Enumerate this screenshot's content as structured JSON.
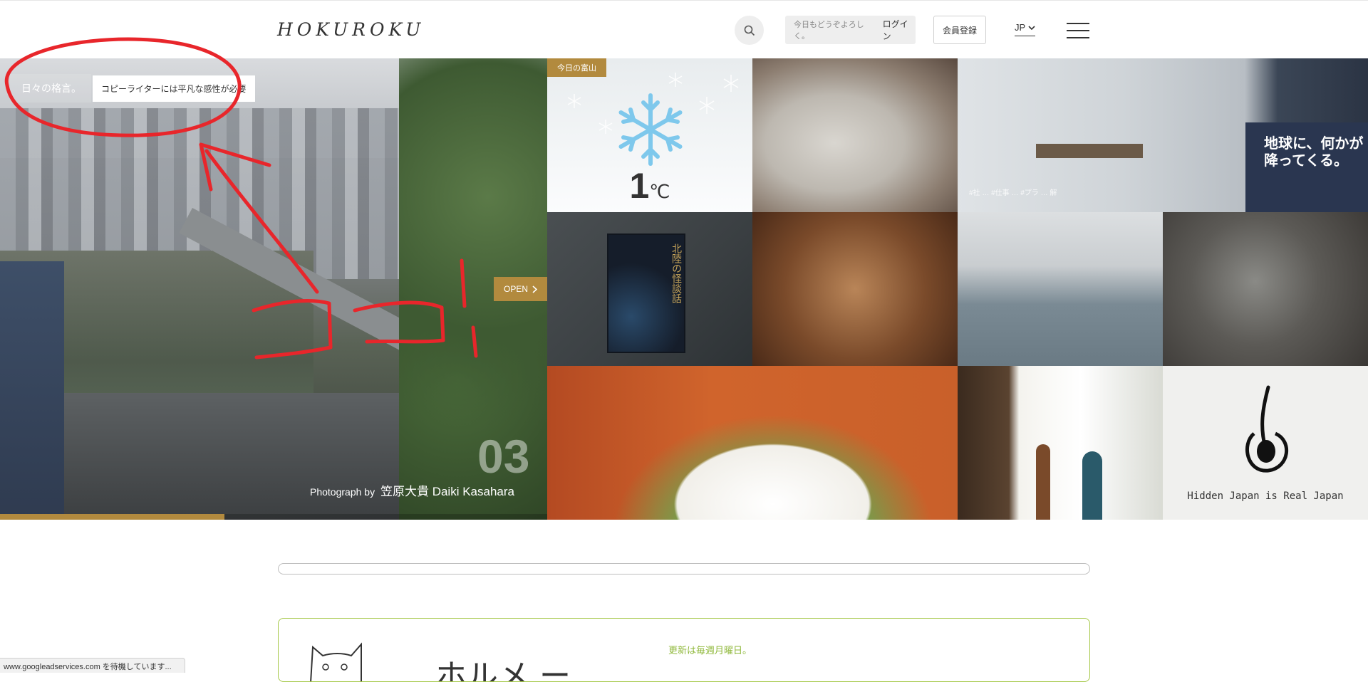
{
  "header": {
    "logo": "HOKUROKU",
    "login_placeholder": "今日もどうぞよろしく。",
    "login_label": "ログイン",
    "register_label": "会員登録",
    "language": "JP"
  },
  "hero": {
    "quote_title": "日々の格言。",
    "quote_text": "コピーライターには平凡な感性が必要",
    "open_label": "OPEN",
    "slide_number": "03",
    "credit_prefix": "Photograph by",
    "credit_name": "笠原大貴 Daiki Kasahara",
    "progress": 0.41
  },
  "weather": {
    "badge": "今日の富山",
    "temperature": "1",
    "unit": "℃",
    "icon": "snowflake-icon"
  },
  "tiles": {
    "office_caption": "#社 … #仕事 … #プラ … 解",
    "office_poster": "地球に、何かが降ってくる。",
    "book_title": "北陸の怪談話",
    "hidden_tagline": "Hidden Japan is Real Japan"
  },
  "promo": {
    "update_text": "更新は毎週月曜日。",
    "kanji": "ホルメ ー"
  },
  "status_bar": {
    "text": "www.googleadservices.com を待機しています..."
  },
  "colors": {
    "accent": "#b28a3e",
    "annotation": "#e8262b",
    "promo_border": "#a6c94a"
  }
}
